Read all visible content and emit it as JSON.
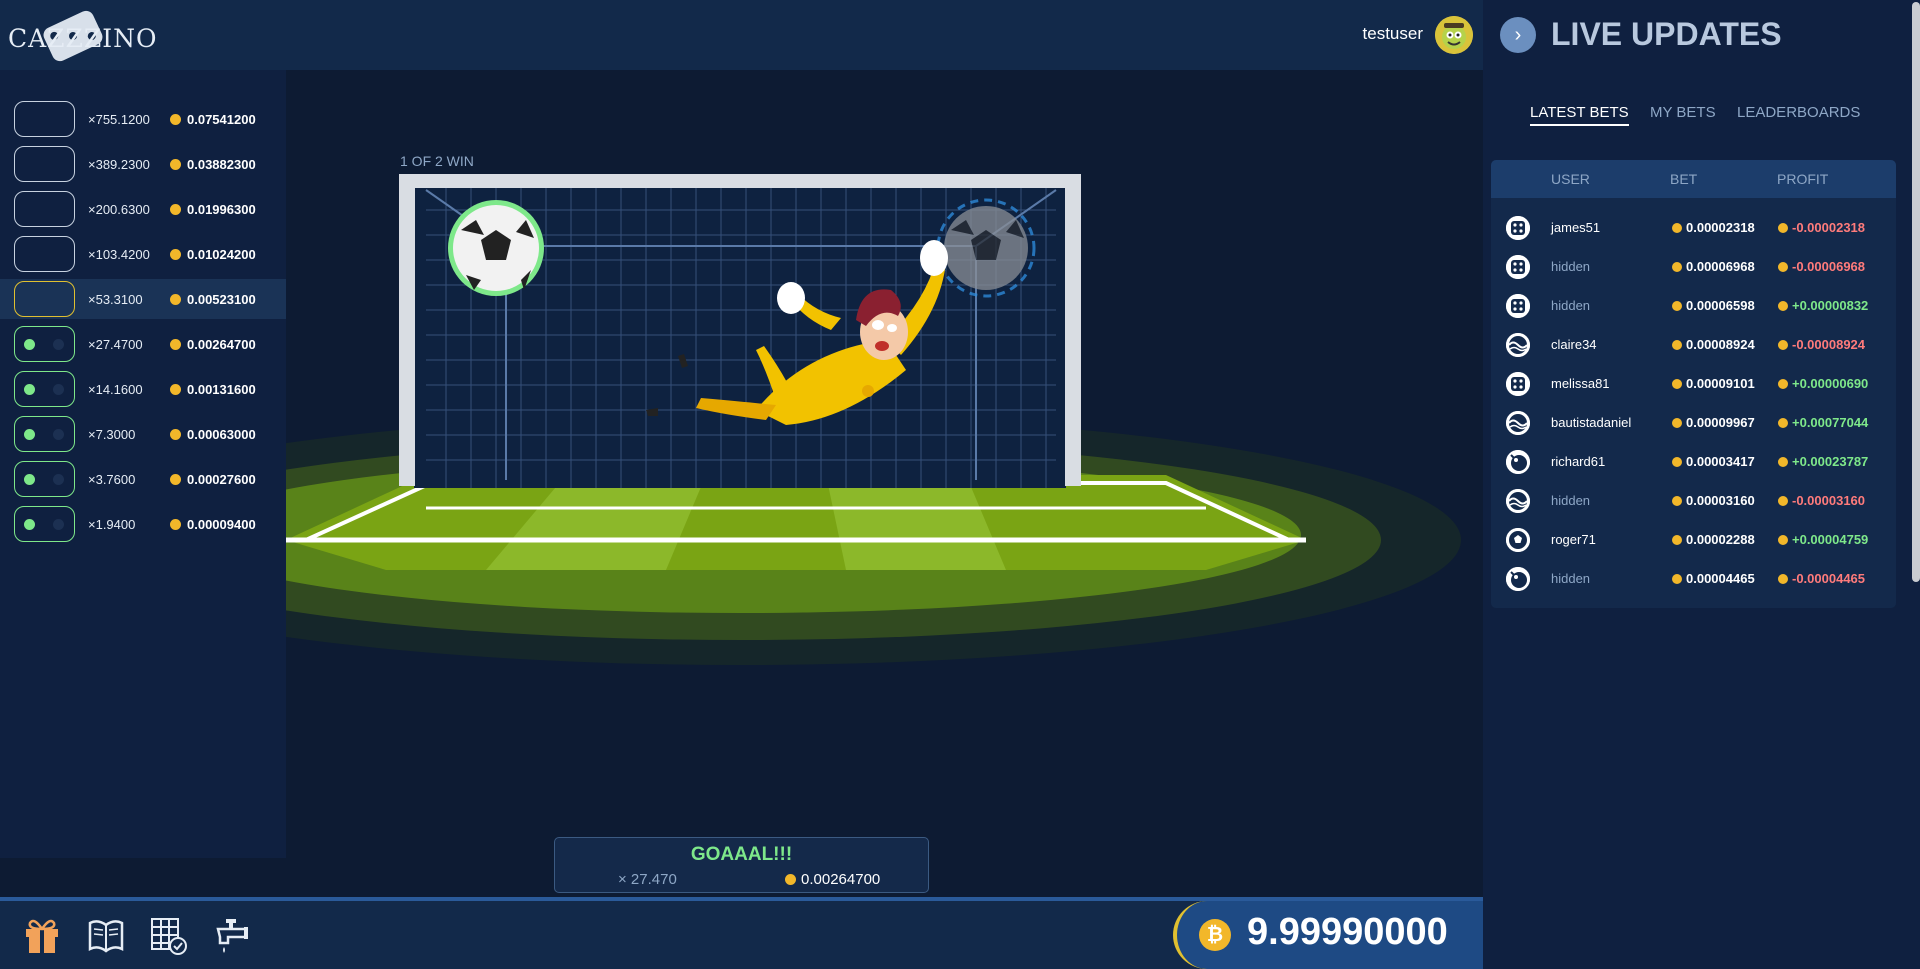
{
  "header": {
    "logo_text": "CAZZZINO",
    "username": "testuser"
  },
  "multipliers": [
    {
      "label": "×755.1200",
      "value": "0.07541200",
      "state": "empty"
    },
    {
      "label": "×389.2300",
      "value": "0.03882300",
      "state": "empty"
    },
    {
      "label": "×200.6300",
      "value": "0.01996300",
      "state": "empty"
    },
    {
      "label": "×103.4200",
      "value": "0.01024200",
      "state": "empty"
    },
    {
      "label": "×53.3100",
      "value": "0.00523100",
      "state": "current"
    },
    {
      "label": "×27.4700",
      "value": "0.00264700",
      "state": "won"
    },
    {
      "label": "×14.1600",
      "value": "0.00131600",
      "state": "won"
    },
    {
      "label": "×7.3000",
      "value": "0.00063000",
      "state": "won"
    },
    {
      "label": "×3.7600",
      "value": "0.00027600",
      "state": "won"
    },
    {
      "label": "×1.9400",
      "value": "0.00009400",
      "state": "won"
    }
  ],
  "game": {
    "win_label": "1 OF 2 WIN"
  },
  "result": {
    "title": "GOAAAL!!!",
    "multiplier": "× 27.470",
    "amount": "0.00264700"
  },
  "bottom": {
    "balance": "9.99990000",
    "balance_symbol": "₿"
  },
  "live": {
    "title": "LIVE UPDATES",
    "tabs": [
      "LATEST BETS",
      "MY BETS",
      "LEADERBOARDS"
    ],
    "columns": [
      "USER",
      "BET",
      "PROFIT"
    ],
    "rows": [
      {
        "user": "james51",
        "bet": "0.00002318",
        "profit": "-0.00002318",
        "icon": "dice-icon"
      },
      {
        "user": "hidden",
        "bet": "0.00006968",
        "profit": "-0.00006968",
        "icon": "dice-icon"
      },
      {
        "user": "hidden",
        "bet": "0.00006598",
        "profit": "+0.00000832",
        "icon": "dice-icon"
      },
      {
        "user": "claire34",
        "bet": "0.00008924",
        "profit": "-0.00008924",
        "icon": "wave-icon"
      },
      {
        "user": "melissa81",
        "bet": "0.00009101",
        "profit": "+0.00000690",
        "icon": "dice-icon"
      },
      {
        "user": "bautistadaniel",
        "bet": "0.00009967",
        "profit": "+0.00077044",
        "icon": "wave-icon"
      },
      {
        "user": "richard61",
        "bet": "0.00003417",
        "profit": "+0.00023787",
        "icon": "bomb-icon"
      },
      {
        "user": "hidden",
        "bet": "0.00003160",
        "profit": "-0.00003160",
        "icon": "wave-icon"
      },
      {
        "user": "roger71",
        "bet": "0.00002288",
        "profit": "+0.00004759",
        "icon": "soccer-ball-icon"
      },
      {
        "user": "hidden",
        "bet": "0.00004465",
        "profit": "-0.00004465",
        "icon": "bomb-icon"
      }
    ]
  }
}
